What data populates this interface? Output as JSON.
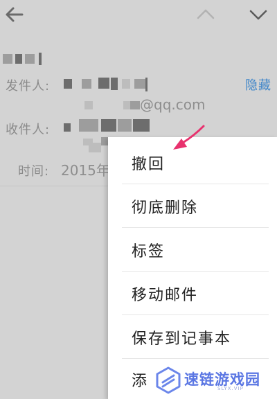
{
  "header": {
    "back_icon": "arrow-left-icon",
    "prev_icon": "chevron-up-icon",
    "next_icon": "chevron-down-icon"
  },
  "mail": {
    "sender_label": "发件人:",
    "sender_email_suffix": "@qq.com",
    "hide_label": "隐藏",
    "recipient_label": "收件人:",
    "time_label": "时间:",
    "time_value": "2015年"
  },
  "menu": {
    "items": [
      {
        "label": "撤回"
      },
      {
        "label": "彻底删除"
      },
      {
        "label": "标签"
      },
      {
        "label": "移动邮件"
      },
      {
        "label": "保存到记事本"
      },
      {
        "label": "添"
      }
    ]
  },
  "watermark": {
    "text": "速链游戏园",
    "sub": "SLYX.VIP"
  },
  "colors": {
    "background": "#d3d3d3",
    "menu_bg": "#ffffff",
    "link_blue": "#3f86c9",
    "arrow_pink": "#e8326e"
  }
}
